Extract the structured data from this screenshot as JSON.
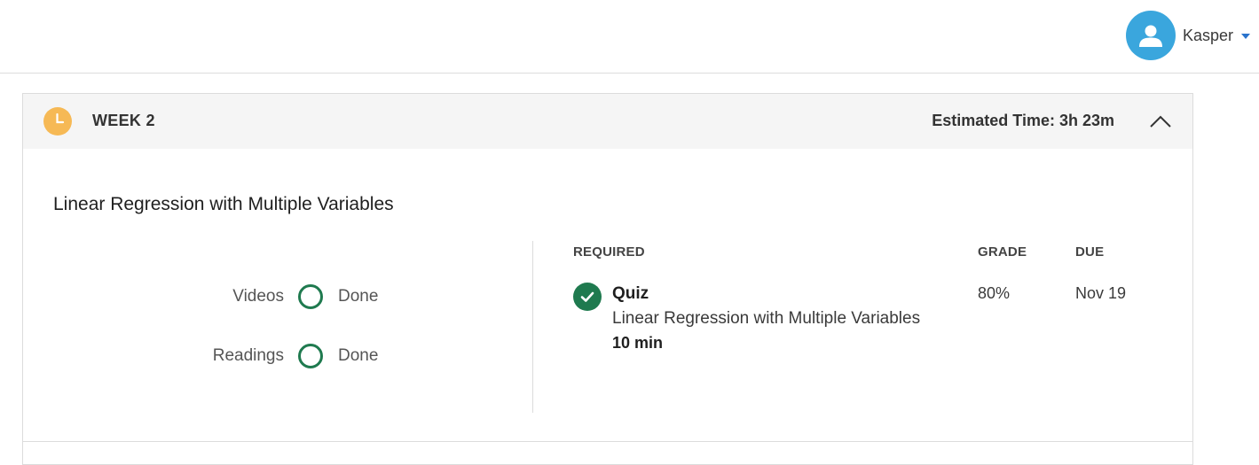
{
  "user": {
    "name": "Kasper",
    "avatar_icon": "user-avatar-icon",
    "avatar_color": "#3aa6dd",
    "caret_color": "#2a73cc"
  },
  "week": {
    "label": "WEEK 2",
    "estimated_time": "Estimated Time: 3h 23m",
    "clock_color": "#f6b955",
    "header_bg": "#f5f5f5",
    "collapse_icon": "chevron-up-icon"
  },
  "lesson": {
    "title": "Linear Regression with Multiple Variables",
    "progress": [
      {
        "label": "Videos",
        "status": "Done"
      },
      {
        "label": "Readings",
        "status": "Done"
      }
    ]
  },
  "assignments": {
    "headers": {
      "required": "REQUIRED",
      "grade": "GRADE",
      "due": "DUE"
    },
    "items": [
      {
        "type": "Quiz",
        "name": "Linear Regression with Multiple Variables",
        "duration": "10 min",
        "grade": "80%",
        "due": "Nov 19",
        "completed": true,
        "status_color": "#1f7a4f"
      }
    ]
  }
}
